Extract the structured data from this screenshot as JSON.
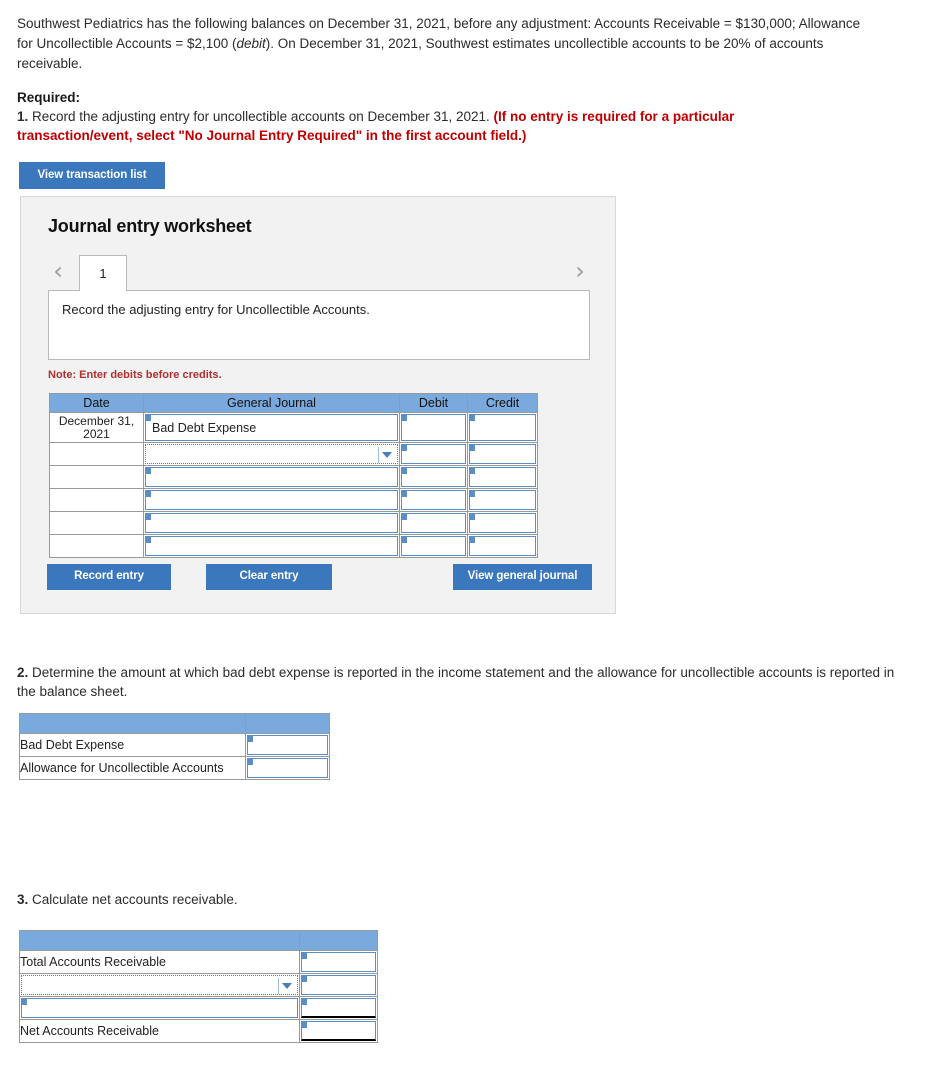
{
  "intro": {
    "part1": "Southwest Pediatrics has the following balances on December 31, 2021, before any adjustment: Accounts Receivable = $130,000; Allowance for Uncollectible Accounts = $2,100 (",
    "italic": "debit",
    "part2": "). On December 31, 2021, Southwest estimates uncollectible accounts to be 20% of accounts receivable."
  },
  "required": {
    "label": "Required:",
    "item_number": "1.",
    "item_text": " Record the adjusting entry for uncollectible accounts on December 31, 2021. ",
    "red_text": "(If no entry is required for a particular transaction/event, select \"No Journal Entry Required\" in the first account field.)"
  },
  "buttons": {
    "view_transaction_list": "View transaction list",
    "record_entry": "Record entry",
    "clear_entry": "Clear entry",
    "view_general_journal": "View general journal"
  },
  "worksheet": {
    "title": "Journal entry worksheet",
    "prev_icon": "chevron-left-icon",
    "next_icon": "chevron-right-icon",
    "tabs": [
      "1"
    ],
    "active_tab": "1",
    "instruction": "Record the adjusting entry for Uncollectible Accounts.",
    "note": "Note: Enter debits before credits.",
    "table": {
      "headers": [
        "Date",
        "General Journal",
        "Debit",
        "Credit"
      ],
      "rows": [
        {
          "date": "December 31, 2021",
          "account": "Bad Debt Expense",
          "debit": "",
          "credit": "",
          "dropdown": false
        },
        {
          "date": "",
          "account": "",
          "debit": "",
          "credit": "",
          "dropdown": true,
          "focused": true
        },
        {
          "date": "",
          "account": "",
          "debit": "",
          "credit": "",
          "dropdown": false
        },
        {
          "date": "",
          "account": "",
          "debit": "",
          "credit": "",
          "dropdown": false
        },
        {
          "date": "",
          "account": "",
          "debit": "",
          "credit": "",
          "dropdown": false
        },
        {
          "date": "",
          "account": "",
          "debit": "",
          "credit": "",
          "dropdown": false
        }
      ]
    }
  },
  "question2": {
    "number": "2.",
    "text": " Determine the amount at which bad debt expense is reported in the income statement and the allowance for uncollectible accounts is reported in the balance sheet.",
    "table": {
      "header": [
        "",
        ""
      ],
      "rows": [
        {
          "label": "Bad Debt Expense",
          "value": ""
        },
        {
          "label": "Allowance for Uncollectible Accounts",
          "value": ""
        }
      ]
    }
  },
  "question3": {
    "number": "3.",
    "text": " Calculate net accounts receivable.",
    "table": {
      "header": [
        "",
        ""
      ],
      "rows": [
        {
          "label": "Total Accounts Receivable",
          "value": "",
          "dropdown": false,
          "total": false
        },
        {
          "label": "",
          "value": "",
          "dropdown": true,
          "focused": true,
          "total": false
        },
        {
          "label": "",
          "value": "",
          "dropdown": false,
          "total": false
        },
        {
          "label": "Net Accounts Receivable",
          "value": "",
          "dropdown": false,
          "total": true
        }
      ]
    }
  },
  "colors": {
    "button_blue": "#3a77bc",
    "header_blue": "#7aa9dd",
    "note_red": "#b03030",
    "required_red": "#c00000",
    "panel_bg": "#f2f2f2"
  }
}
